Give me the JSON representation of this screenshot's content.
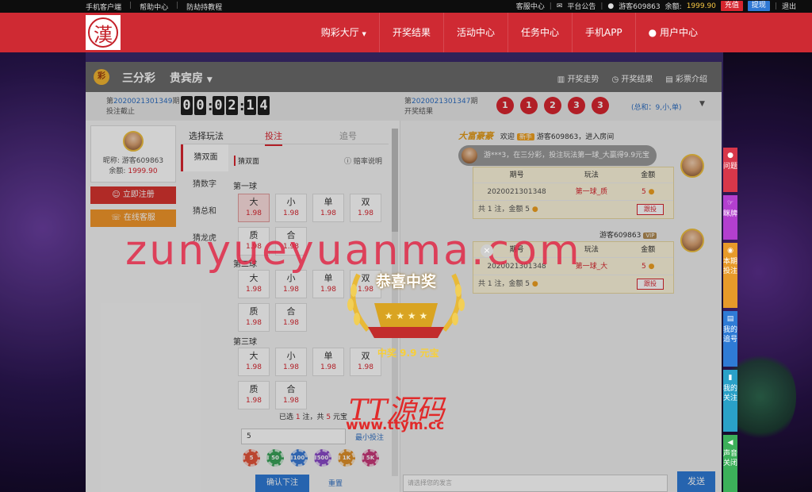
{
  "topbar": {
    "left": [
      "手机客户端",
      "帮助中心",
      "防劫持教程"
    ],
    "service": "客服中心",
    "notice": "平台公告",
    "user": "游客609863",
    "balance_label": "余额:",
    "balance": "1999.90",
    "recharge": "充值",
    "withdraw": "提现",
    "logout": "退出"
  },
  "nav": {
    "logo_char": "漢",
    "items": [
      "购彩大厅",
      "开奖结果",
      "活动中心",
      "任务中心",
      "手机APP",
      "用户中心"
    ]
  },
  "game": {
    "icon_text": "彩",
    "name": "三分彩",
    "room": "贵宾房",
    "links": [
      "开奖走势",
      "开奖结果",
      "彩票介绍"
    ],
    "current_prefix": "第",
    "current_issue": "2020021301349",
    "current_suffix": "期",
    "current_status": "投注截止",
    "timer": [
      "0",
      "0",
      "0",
      "2",
      "1",
      "4"
    ],
    "last_prefix": "第",
    "last_issue": "2020021301347",
    "last_suffix": "期",
    "last_label": "开奖结果",
    "balls": [
      "1",
      "1",
      "2",
      "3",
      "3"
    ],
    "sum": "(总和：9,小,单)"
  },
  "user_box": {
    "nick_label": "昵称:",
    "nick": "游客609863",
    "balance_label": "余额:",
    "balance": "1999.90",
    "register": "立即注册",
    "service": "在线客服"
  },
  "tabs": {
    "choose": "选择玩法",
    "bet": "投注",
    "chase": "追号"
  },
  "left_menu": [
    "猜双面",
    "猜数字",
    "猜总和",
    "猜龙虎"
  ],
  "rule": {
    "title": "猜双面",
    "help": "赔率说明"
  },
  "balls_section": [
    {
      "label": "第一球",
      "options": [
        {
          "name": "大",
          "odds": "1.98"
        },
        {
          "name": "小",
          "odds": "1.98"
        },
        {
          "name": "单",
          "odds": "1.98"
        },
        {
          "name": "双",
          "odds": "1.98"
        },
        {
          "name": "质",
          "odds": "1.98"
        },
        {
          "name": "合",
          "odds": "1.98"
        }
      ]
    },
    {
      "label": "第二球",
      "options": [
        {
          "name": "大",
          "odds": "1.98"
        },
        {
          "name": "小",
          "odds": "1.98"
        },
        {
          "name": "单",
          "odds": "1.98"
        },
        {
          "name": "双",
          "odds": "1.98"
        },
        {
          "name": "质",
          "odds": "1.98"
        },
        {
          "name": "合",
          "odds": "1.98"
        }
      ]
    },
    {
      "label": "第三球",
      "options": [
        {
          "name": "大",
          "odds": "1.98"
        },
        {
          "name": "小",
          "odds": "1.98"
        },
        {
          "name": "单",
          "odds": "1.98"
        },
        {
          "name": "双",
          "odds": "1.98"
        },
        {
          "name": "质",
          "odds": "1.98"
        },
        {
          "name": "合",
          "odds": "1.98"
        }
      ]
    }
  ],
  "selection": {
    "pre": "已选",
    "count": "1",
    "mid": "注，共",
    "total": "5",
    "unit": "元宝"
  },
  "amount": "5",
  "min_bet": "最小投注",
  "chips": [
    "5",
    "50",
    "100",
    "500",
    "1K",
    "5K"
  ],
  "confirm": "确认下注",
  "reset": "重置",
  "chat": {
    "vip": "大富豪豪",
    "welcome_pre": "欢迎",
    "welcome_tag": "新手",
    "welcome_msg": "游客609863，进入房间",
    "win_msg": "游***3，在三分彩，投注玩法第一球_大赢得9.9元宝",
    "table_head": [
      "期号",
      "玩法",
      "金额"
    ],
    "bets": [
      {
        "issue": "2020021301348",
        "play": "第一球_质",
        "amount": "5",
        "total": "共 1 注，金额 5",
        "follow": "跟投"
      },
      {
        "issue": "2020021301348",
        "play": "第一球_大",
        "amount": "5",
        "total": "共 1 注，金额 5",
        "follow": "跟投"
      }
    ],
    "user2": "游客609863",
    "input_placeholder": "请选择您的发言",
    "send": "发送"
  },
  "popup": {
    "title": "恭喜中奖",
    "prize": "中奖 9.9 元宝"
  },
  "watermark": "zunyueyuanma.com",
  "brand": {
    "line1": "TT源码",
    "line2": "www.ttym.cc"
  },
  "sidebar": [
    "问题",
    "眯牌",
    "本期投注",
    "我的追号",
    "我的关注",
    "声音关闭"
  ],
  "colors": {
    "nav": "#cf2a33",
    "accent_red": "#d8252f",
    "accent_blue": "#2f7bd6",
    "gold": "#f7cf3a"
  }
}
